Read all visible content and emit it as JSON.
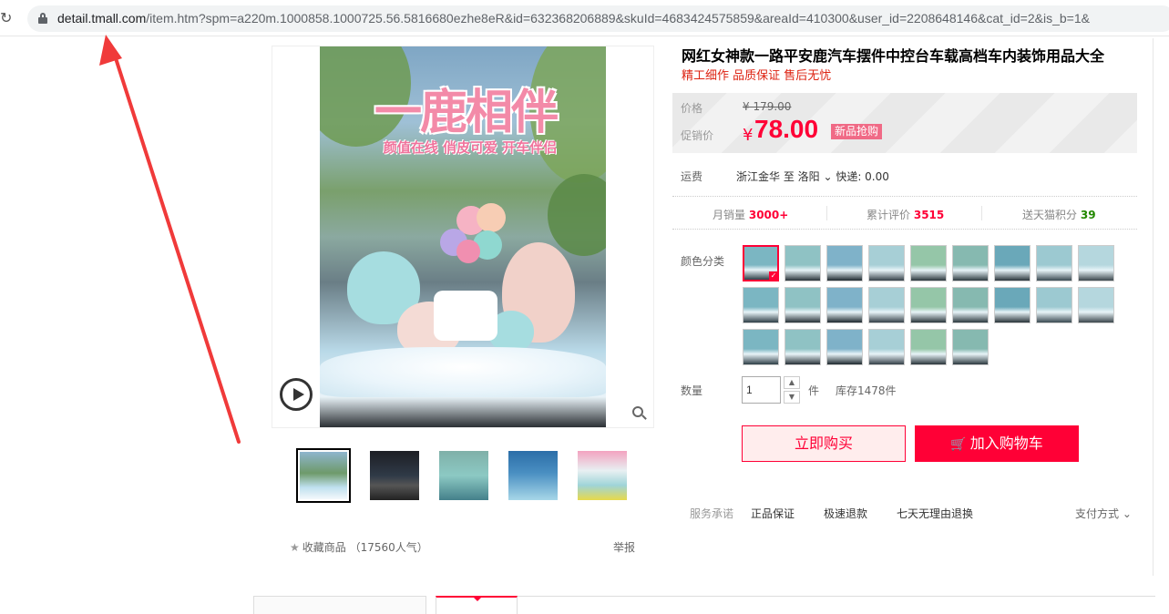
{
  "browser": {
    "reload_icon": "reload-icon",
    "lock_icon": "lock-icon",
    "url_host": "detail.tmall.com",
    "url_path": "/item.htm?spm=a220m.1000858.1000725.56.5816680ezhe8eR&id=632368206889&skuId=4683424575859&areaId=410300&user_id=2208648146&cat_id=2&is_b=1&"
  },
  "gallery": {
    "photo_title": "一鹿相伴",
    "photo_subtitle": "颜值在线 俏皮可爱 开车伴侣",
    "play_icon": "play-icon",
    "zoom_icon": "zoom-icon"
  },
  "actions": {
    "favorite_label": "收藏商品",
    "favorite_count": "（17560人气）",
    "report_label": "举报"
  },
  "product": {
    "title": "网红女神款一路平安鹿汽车摆件中控台车载高档车内装饰用品大全",
    "subtitle": "精工细作 品质保证 售后无忧"
  },
  "price": {
    "orig_label": "价格",
    "orig_value": "¥ 179.00",
    "promo_label": "促销价",
    "currency": "¥",
    "promo_value": "78.00",
    "promo_badge": "新品抢购"
  },
  "shipping": {
    "label": "运费",
    "value": "浙江金华  至 洛阳 ⌄  快递: 0.00"
  },
  "stats": {
    "monthly_sales_label": "月销量",
    "monthly_sales_value": "3000+",
    "reviews_label": "累计评价",
    "reviews_value": "3515",
    "points_label": "送天猫积分",
    "points_value": "39"
  },
  "sku": {
    "color_label": "颜色分类",
    "swatch_count_row1": 9,
    "swatch_count_row2": 9,
    "swatch_count_row3": 6
  },
  "quantity": {
    "label": "数量",
    "value": "1",
    "unit": "件",
    "stock": "库存1478件"
  },
  "buttons": {
    "buy_now": "立即购买",
    "add_cart": "加入购物车"
  },
  "service": {
    "label": "服务承诺",
    "items": [
      "正品保证",
      "极速退款",
      "七天无理由退换"
    ],
    "pay_method": "支付方式 ⌄"
  },
  "colors": {
    "accent": "#ff0036",
    "annotation_arrow": "#f03a3a"
  }
}
